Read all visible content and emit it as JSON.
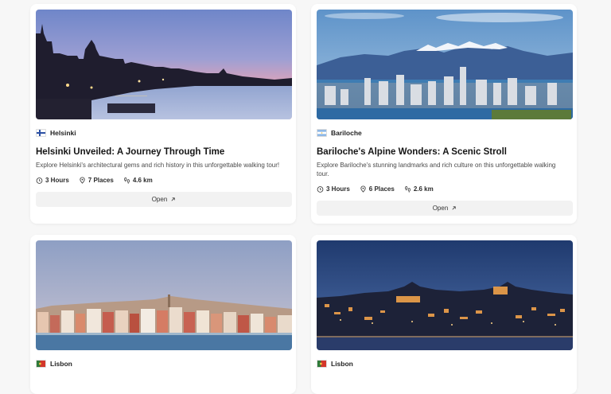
{
  "cards": [
    {
      "city": "Helsinki",
      "title": "Helsinki Unveiled: A Journey Through Time",
      "description": "Explore Helsinki's architectural gems and rich history in this unforgettable walking tour!",
      "stats": {
        "duration": "3 Hours",
        "places": "7 Places",
        "distance": "4.6 km"
      },
      "open_label": "Open",
      "flag_icon": "finland-flag-icon"
    },
    {
      "city": "Bariloche",
      "title": "Bariloche's Alpine Wonders: A Scenic Stroll",
      "description": "Explore Bariloche's stunning landmarks and rich culture on this unforgettable walking tour.",
      "stats": {
        "duration": "3 Hours",
        "places": "6 Places",
        "distance": "2.6 km"
      },
      "open_label": "Open",
      "flag_icon": "argentina-flag-icon"
    },
    {
      "city": "Lisbon",
      "flag_icon": "portugal-flag-icon"
    },
    {
      "city": "Lisbon",
      "flag_icon": "portugal-flag-icon"
    }
  ]
}
